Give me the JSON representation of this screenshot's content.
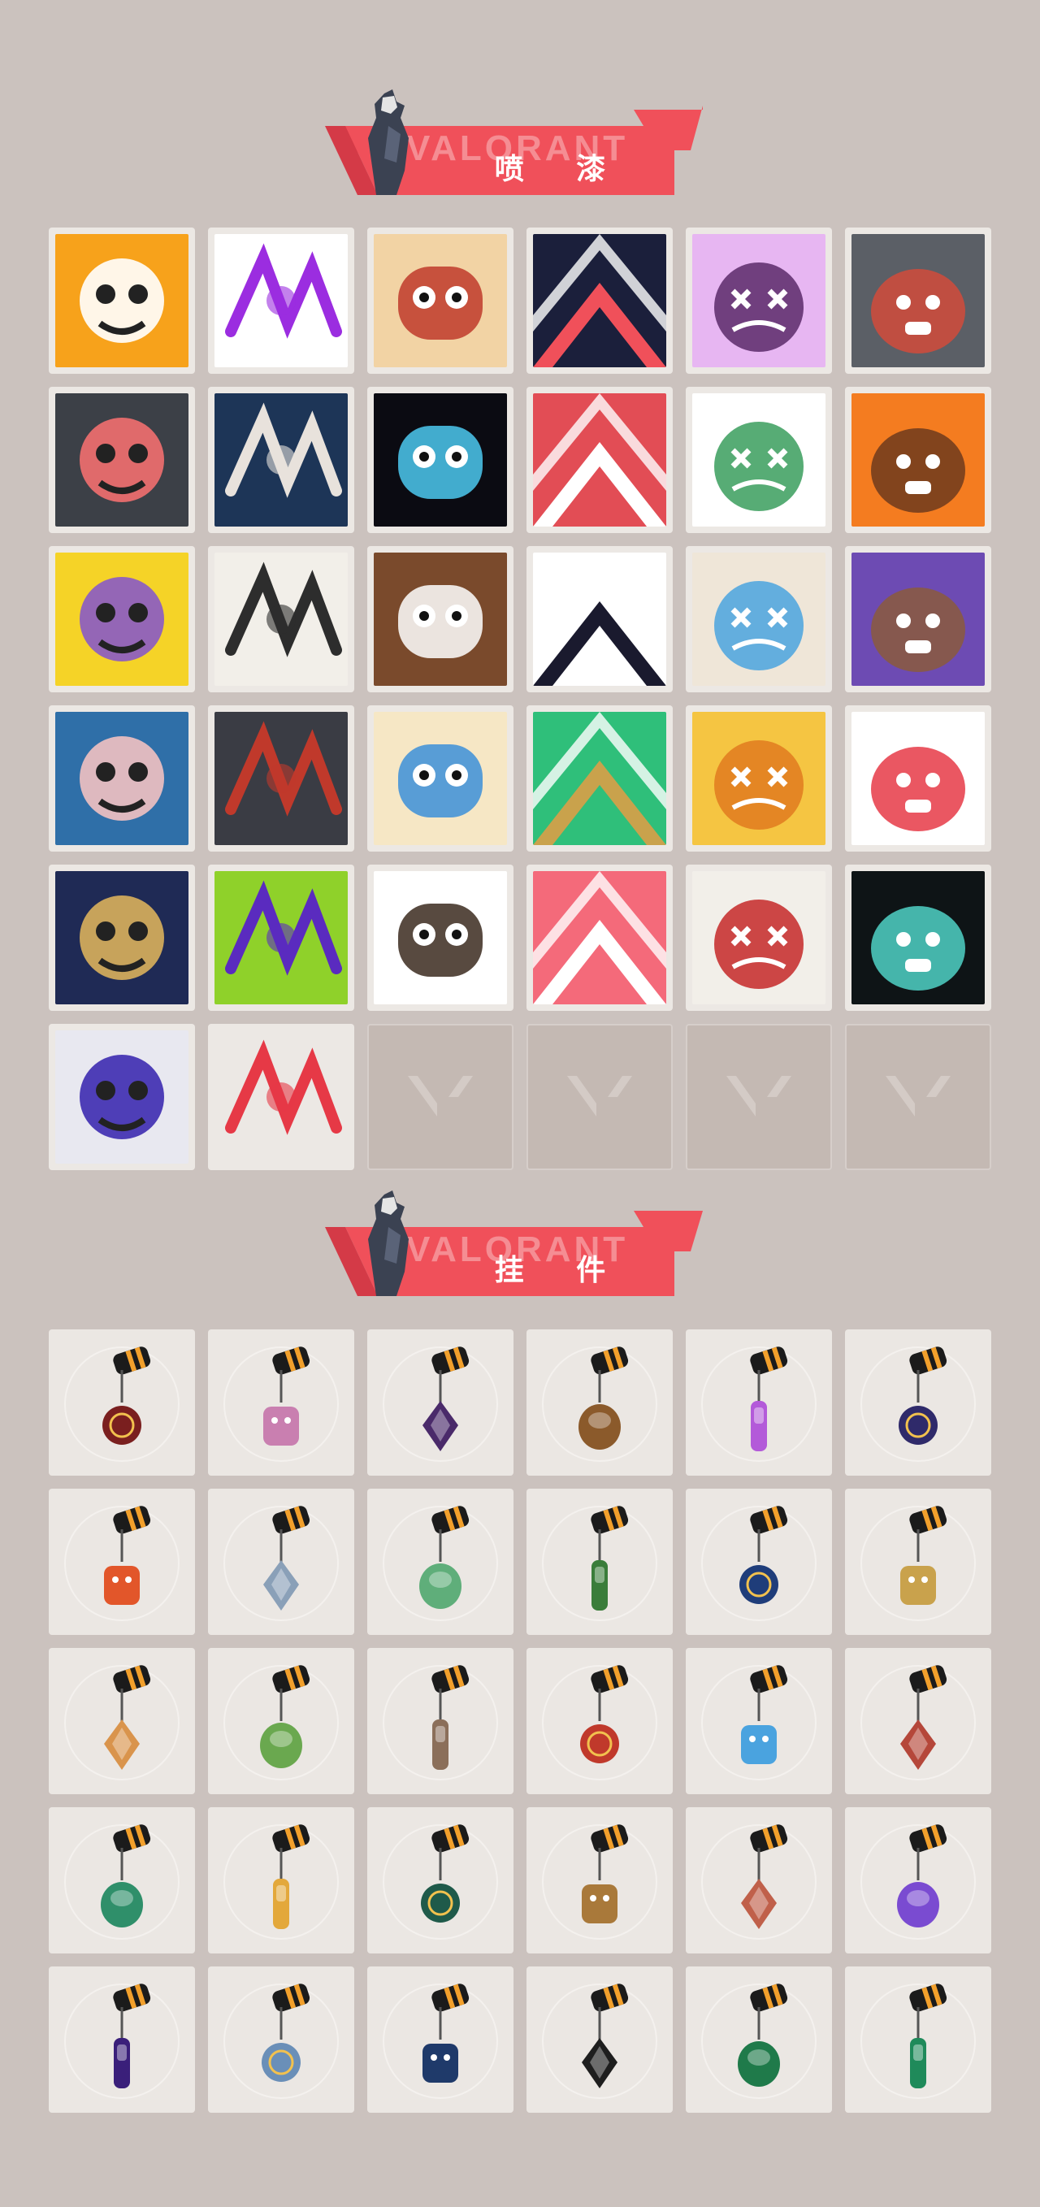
{
  "background_color": "#cbc2be",
  "accent_color": "#f0505a",
  "sprays_section": {
    "title": "喷 漆",
    "banner_ghost_text": "VALORANT",
    "items": [
      {
        "name": "orange-creature-spray-icon",
        "bg": "#f7a21b",
        "fg": "#ffffff"
      },
      {
        "name": "purple-signature-spray-icon",
        "bg": "#ffffff",
        "fg": "#9b2de0"
      },
      {
        "name": "goggles-character-spray-icon",
        "bg": "#f2d3a4",
        "fg": "#c0392b"
      },
      {
        "name": "chevron-stripes-spray-icon",
        "bg": "#1b1f3b",
        "fg": "#f0505a"
      },
      {
        "name": "purple-dizzy-face-spray-icon",
        "bg": "#e7b6f2",
        "fg": "#5a2a6a"
      },
      {
        "name": "crying-seal-spray-icon",
        "bg": "#5b5f66",
        "fg": "#d24b3b"
      },
      {
        "name": "gray-cat-spray-icon",
        "bg": "#3c4047",
        "fg": "#f26f6f"
      },
      {
        "name": "hooded-agent-spray-icon",
        "bg": "#1d3557",
        "fg": "#e8e2dc"
      },
      {
        "name": "blue-logo-spray-icon",
        "bg": "#0b0b12",
        "fg": "#4cc9f0"
      },
      {
        "name": "numbers-ii0-spray-icon",
        "bg": "#e24d55",
        "fg": "#ffffff"
      },
      {
        "name": "laughing-agent-spray-icon",
        "bg": "#ffffff",
        "fg": "#3a9d5d"
      },
      {
        "name": "happy-agent-spray-icon",
        "bg": "#f47c20",
        "fg": "#6d3b1d"
      },
      {
        "name": "yellow-blob-spray-icon",
        "bg": "#f5d327",
        "fg": "#8a5ac7"
      },
      {
        "name": "masked-agent-number-spray-icon",
        "bg": "#f2efe9",
        "fg": "#2d2d2d"
      },
      {
        "name": "smiling-bearded-agent-spray-icon",
        "bg": "#7a4a2c",
        "fg": "#ffffff"
      },
      {
        "name": "winking-agent-spray-icon",
        "bg": "#ffffff",
        "fg": "#1a1a2e"
      },
      {
        "name": "crying-blonde-agent-spray-icon",
        "bg": "#efe6d8",
        "fg": "#4aa3df"
      },
      {
        "name": "smug-agent-spray-icon",
        "bg": "#6d4bb3",
        "fg": "#8b5a3c"
      },
      {
        "name": "screaming-agent-spray-icon",
        "bg": "#2f6fa8",
        "fg": "#f2c1c1"
      },
      {
        "name": "open-mouth-seal-spray-icon",
        "bg": "#3a3c44",
        "fg": "#c0392b"
      },
      {
        "name": "blonde-agent-face-spray-icon",
        "bg": "#f6e7c5",
        "fg": "#3c8fd8"
      },
      {
        "name": "gold-star-emblem-spray-icon",
        "bg": "#2fbf7a",
        "fg": "#c9a24c"
      },
      {
        "name": "duck-beak-spray-icon",
        "bg": "#f5c542",
        "fg": "#e07a1f"
      },
      {
        "name": "red-slash-spray-icon",
        "bg": "#ffffff",
        "fg": "#e63946"
      },
      {
        "name": "golden-waves-spray-icon",
        "bg": "#1f2a55",
        "fg": "#d9b05c"
      },
      {
        "name": "green-slime-spray-icon",
        "bg": "#8fd12a",
        "fg": "#5a2bbf"
      },
      {
        "name": "glasses-agent-spray-icon",
        "bg": "#ffffff",
        "fg": "#3b2a1e"
      },
      {
        "name": "pixel-heart-spray-icon",
        "bg": "#f46a7a",
        "fg": "#ffffff"
      },
      {
        "name": "x-button-spray-icon",
        "bg": "#f2efe9",
        "fg": "#c62828"
      },
      {
        "name": "valorant-logo-splash-spray-icon",
        "bg": "#0e1416",
        "fg": "#4fd1c5"
      },
      {
        "name": "purple-graffiti-spray-icon",
        "bg": "#e8e8f0",
        "fg": "#3d2bb0"
      },
      {
        "name": "red-valorant-drip-spray-icon",
        "bg": "#ece8e4",
        "fg": "#e63946"
      }
    ],
    "empty_slots": 4
  },
  "buddies_section": {
    "title": "挂 件",
    "banner_ghost_text": "VALORANT",
    "items": [
      {
        "name": "braided-cord-buddy-icon",
        "color": "#7a1f1f"
      },
      {
        "name": "cupcake-buddy-icon",
        "color": "#c97fb0"
      },
      {
        "name": "ep9-medallion-buddy-icon",
        "color": "#4a2a6a"
      },
      {
        "name": "crate-buddy-icon",
        "color": "#8b5a2b"
      },
      {
        "name": "lava-lamp-buddy-icon",
        "color": "#b35ad9"
      },
      {
        "name": "ep9-medallion-dark-buddy-icon",
        "color": "#2f2a6a"
      },
      {
        "name": "skewer-buddy-icon",
        "color": "#e2562a"
      },
      {
        "name": "agent-figure-buddy-icon",
        "color": "#8aa0b8"
      },
      {
        "name": "robot-buddy-icon",
        "color": "#5fae7a"
      },
      {
        "name": "soda-can-buddy-icon",
        "color": "#3a7d3a"
      },
      {
        "name": "ep9-blue-medallion-buddy-icon",
        "color": "#1f3d7a"
      },
      {
        "name": "golden-robot-buddy-icon",
        "color": "#c9a24c"
      },
      {
        "name": "fox-buddy-icon",
        "color": "#d9944c"
      },
      {
        "name": "green-frog-buddy-icon",
        "color": "#6aa84f"
      },
      {
        "name": "raccoon-buddy-icon",
        "color": "#8b6f5a"
      },
      {
        "name": "mech-warrior-buddy-icon",
        "color": "#c0392b"
      },
      {
        "name": "blue-crystal-blade-buddy-icon",
        "color": "#4aa3df"
      },
      {
        "name": "red-octopus-buddy-icon",
        "color": "#b5473a"
      },
      {
        "name": "green-diamond-buddy-icon",
        "color": "#2f8f6a"
      },
      {
        "name": "sun-cloud-buddy-icon",
        "color": "#e3a83b"
      },
      {
        "name": "ep8-green-medallion-buddy-icon",
        "color": "#1f5a4a"
      },
      {
        "name": "pretzel-buddy-icon",
        "color": "#a9793a"
      },
      {
        "name": "bottle-buddy-icon",
        "color": "#c0604a"
      },
      {
        "name": "purple-flame-flower-buddy-icon",
        "color": "#7a4bd1"
      },
      {
        "name": "ep8-purple-medallion-buddy-icon",
        "color": "#3a1f7a"
      },
      {
        "name": "ufo-buddy-icon",
        "color": "#6a8fb8"
      },
      {
        "name": "ep7-medallion-buddy-icon",
        "color": "#1f3a6a"
      },
      {
        "name": "black-v-badge-buddy-icon",
        "color": "#1e1e1e"
      },
      {
        "name": "green-v-gem-buddy-icon",
        "color": "#1f7a4a"
      },
      {
        "name": "green-e-gem-buddy-icon",
        "color": "#1f8a5a"
      }
    ]
  }
}
